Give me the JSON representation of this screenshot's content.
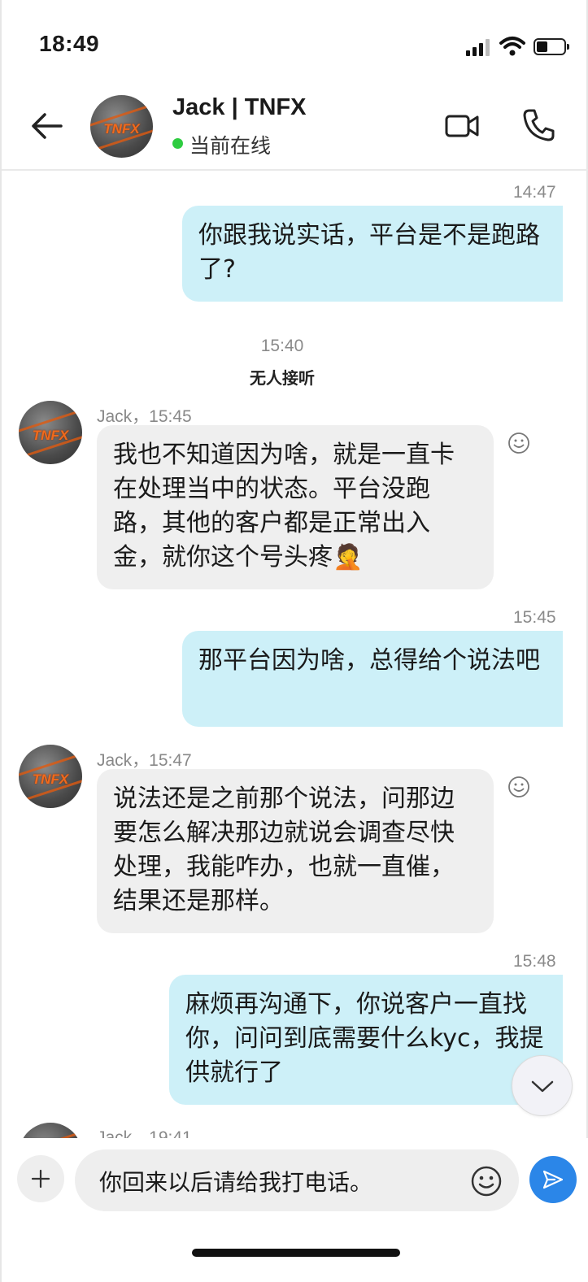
{
  "status_bar": {
    "time": "18:49"
  },
  "header": {
    "contact_name": "Jack | TNFX",
    "status": "当前在线",
    "avatar_logo": "TNFX"
  },
  "messages": [
    {
      "type": "outgoing",
      "time": "14:47",
      "text": "你跟我说实话，平台是不是跑路了?"
    },
    {
      "type": "system",
      "time": "15:40",
      "note": "无人接听"
    },
    {
      "type": "incoming",
      "sender": "Jack，15:45",
      "text": "我也不知道因为啥，就是一直卡在处理当中的状态。平台没跑路，其他的客户都是正常出入金，就你这个号头疼🤦"
    },
    {
      "type": "outgoing",
      "time": "15:45",
      "text": "那平台因为啥，总得给个说法吧"
    },
    {
      "type": "incoming",
      "sender": "Jack，15:47",
      "text": "说法还是之前那个说法，问那边要怎么解决那边就说会调查尽快处理，我能咋办，也就一直催，结果还是那样。"
    },
    {
      "type": "outgoing",
      "time": "15:48",
      "text": "麻烦再沟通下，你说客户一直找你，问问到底需要什么kyc，我提供就行了"
    },
    {
      "type": "incoming-partial",
      "sender": "Jack，19:41"
    }
  ],
  "composer": {
    "text": "你回来以后请给我打电话。"
  },
  "icons": {
    "back": "back-arrow-icon",
    "video": "video-call-icon",
    "phone": "phone-call-icon",
    "react": "smiley-react-icon",
    "scroll": "chevron-down-icon",
    "plus": "plus-icon",
    "emoji": "emoji-icon",
    "send": "send-icon"
  },
  "colors": {
    "outgoing_bubble": "#cdf0f8",
    "incoming_bubble": "#efefef",
    "online": "#2ecc40",
    "send_button": "#2b86e8"
  }
}
